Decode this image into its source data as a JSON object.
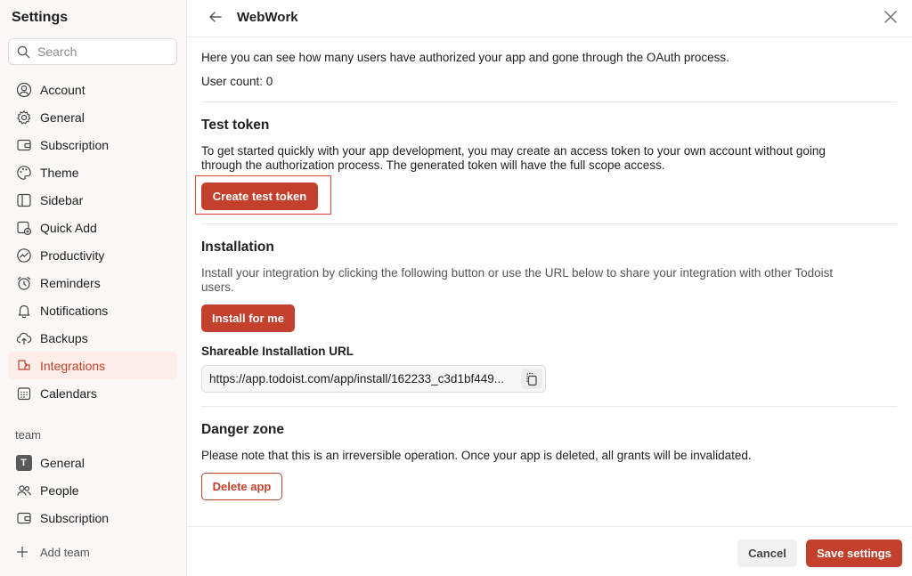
{
  "sidebar": {
    "title": "Settings",
    "search_placeholder": "Search",
    "items": [
      {
        "label": "Account",
        "icon": "account-icon"
      },
      {
        "label": "General",
        "icon": "gear-icon"
      },
      {
        "label": "Subscription",
        "icon": "wallet-icon"
      },
      {
        "label": "Theme",
        "icon": "palette-icon"
      },
      {
        "label": "Sidebar",
        "icon": "sidebar-icon"
      },
      {
        "label": "Quick Add",
        "icon": "quick-add-icon"
      },
      {
        "label": "Productivity",
        "icon": "productivity-icon"
      },
      {
        "label": "Reminders",
        "icon": "alarm-icon"
      },
      {
        "label": "Notifications",
        "icon": "bell-icon"
      },
      {
        "label": "Backups",
        "icon": "cloud-upload-icon"
      },
      {
        "label": "Integrations",
        "icon": "integrations-icon",
        "active": true
      },
      {
        "label": "Calendars",
        "icon": "calendar-icon"
      }
    ],
    "team_label": "team",
    "team_items": [
      {
        "label": "General",
        "icon": "team-badge-icon",
        "badge": "T"
      },
      {
        "label": "People",
        "icon": "people-icon"
      },
      {
        "label": "Subscription",
        "icon": "wallet-icon"
      }
    ],
    "add_team": "Add team"
  },
  "header": {
    "title": "WebWork"
  },
  "oauth": {
    "description": "Here you can see how many users have authorized your app and gone through the OAuth process.",
    "user_count": "User count: 0"
  },
  "test_token": {
    "heading": "Test token",
    "description_line1": "To get started quickly with your app development, you may create an access token to your own account without going",
    "description_line2": "through the authorization process. The generated token will have the full scope access.",
    "button": "Create test token"
  },
  "installation": {
    "heading": "Installation",
    "description_line1": "Install your integration by clicking the following button or use the URL below to share your integration with other Todoist",
    "description_line2": "users.",
    "button": "Install for me",
    "url_label": "Shareable Installation URL",
    "url": "https://app.todoist.com/app/install/162233_c3d1bf449..."
  },
  "danger": {
    "heading": "Danger zone",
    "description": "Please note that this is an irreversible operation. Once your app is deleted, all grants will be invalidated.",
    "button": "Delete app"
  },
  "footer": {
    "cancel": "Cancel",
    "save": "Save settings"
  },
  "colors": {
    "accent": "#c3402c",
    "active_bg": "#fdeee9",
    "highlight_border": "#d9463a"
  }
}
